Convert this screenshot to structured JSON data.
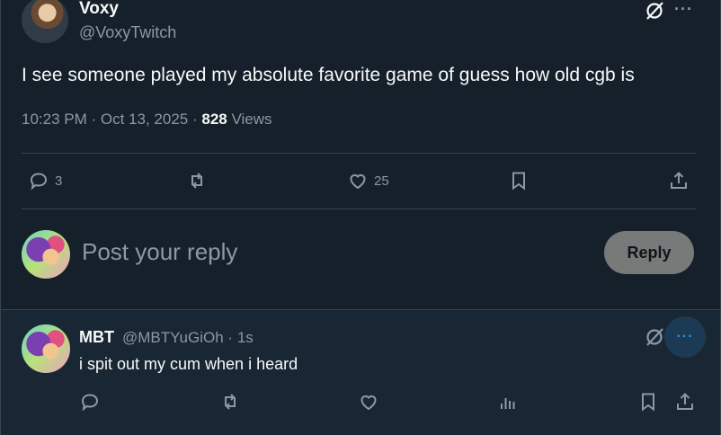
{
  "tweet": {
    "author_name": "Voxy",
    "author_handle": "@VoxyTwitch",
    "text": "I see someone played my absolute favorite game of guess how old cgb is",
    "time": "10:23 PM",
    "date": "Oct 13, 2025",
    "views_count": "828",
    "views_label": "Views",
    "reply_count": "3",
    "like_count": "25",
    "more_label": "···"
  },
  "composer": {
    "placeholder": "Post your reply",
    "button_label": "Reply"
  },
  "reply": {
    "author_name": "MBT",
    "author_handle": "@MBTYuGiOh",
    "time": "1s",
    "text": "i spit out my cum when i heard",
    "more_label": "···"
  },
  "colors": {
    "background": "#15202b",
    "text": "#f7f9f9",
    "secondary_text": "#8b98a5",
    "accent": "#1d9bf0",
    "border": "#38444d"
  },
  "icons": [
    "grok-icon",
    "more-icon",
    "reply-icon",
    "retweet-icon",
    "like-icon",
    "bookmark-icon",
    "share-icon",
    "analytics-icon"
  ]
}
